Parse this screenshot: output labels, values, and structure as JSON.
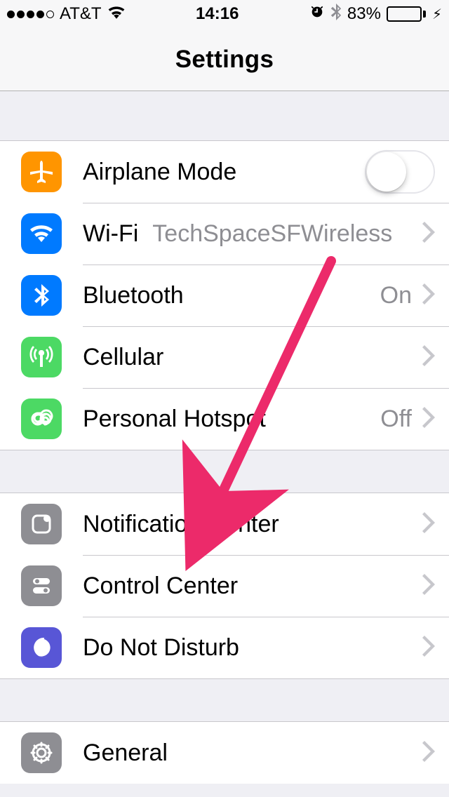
{
  "statusBar": {
    "carrier": "AT&T",
    "time": "14:16",
    "batteryPercent": "83%"
  },
  "header": {
    "title": "Settings"
  },
  "groups": [
    {
      "rows": [
        {
          "icon": "airplane-icon",
          "label": "Airplane Mode",
          "type": "toggle",
          "toggled": false
        },
        {
          "icon": "wifi-icon",
          "label": "Wi-Fi",
          "value": "TechSpaceSFWireless",
          "valueNear": true,
          "type": "link"
        },
        {
          "icon": "bluetooth-icon",
          "label": "Bluetooth",
          "value": "On",
          "type": "link"
        },
        {
          "icon": "cellular-icon",
          "label": "Cellular",
          "type": "link"
        },
        {
          "icon": "hotspot-icon",
          "label": "Personal Hotspot",
          "value": "Off",
          "type": "link"
        }
      ]
    },
    {
      "rows": [
        {
          "icon": "notification-icon",
          "label": "Notification Center",
          "type": "link"
        },
        {
          "icon": "control-center-icon",
          "label": "Control Center",
          "type": "link"
        },
        {
          "icon": "dnd-icon",
          "label": "Do Not Disturb",
          "type": "link"
        }
      ]
    },
    {
      "rows": [
        {
          "icon": "general-icon",
          "label": "General",
          "type": "link"
        }
      ]
    }
  ],
  "annotation": {
    "arrowColor": "#ec2a6a"
  }
}
